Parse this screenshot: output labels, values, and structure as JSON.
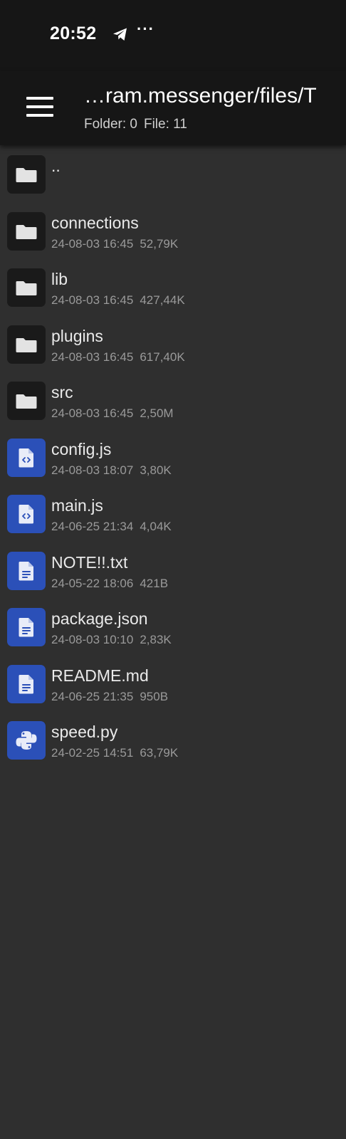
{
  "status_bar": {
    "time": "20:52",
    "notification_icon": "telegram-icon",
    "more_indicator": "···"
  },
  "toolbar": {
    "menu_icon": "hamburger-menu-icon",
    "path": "…ram.messenger/files/T",
    "folder_count": "Folder: 0",
    "file_count": "File: 11"
  },
  "files": [
    {
      "name": "..",
      "date": "",
      "size": "",
      "icon": "folder-icon"
    },
    {
      "name": "connections",
      "date": "24-08-03 16:45",
      "size": "52,79K",
      "icon": "folder-icon"
    },
    {
      "name": "lib",
      "date": "24-08-03 16:45",
      "size": "427,44K",
      "icon": "folder-icon"
    },
    {
      "name": "plugins",
      "date": "24-08-03 16:45",
      "size": "617,40K",
      "icon": "folder-icon"
    },
    {
      "name": "src",
      "date": "24-08-03 16:45",
      "size": "2,50M",
      "icon": "folder-icon"
    },
    {
      "name": "config.js",
      "date": "24-08-03 18:07",
      "size": "3,80K",
      "icon": "code-file-icon"
    },
    {
      "name": "main.js",
      "date": "24-06-25 21:34",
      "size": "4,04K",
      "icon": "code-file-icon"
    },
    {
      "name": "NOTE!!.txt",
      "date": "24-05-22 18:06",
      "size": "421B",
      "icon": "text-file-icon"
    },
    {
      "name": "package.json",
      "date": "24-08-03 10:10",
      "size": "2,83K",
      "icon": "text-file-icon"
    },
    {
      "name": "README.md",
      "date": "24-06-25 21:35",
      "size": "950B",
      "icon": "text-file-icon"
    },
    {
      "name": "speed.py",
      "date": "24-02-25 14:51",
      "size": "63,79K",
      "icon": "python-file-icon"
    }
  ],
  "colors": {
    "background": "#2f2f2f",
    "bar_background": "#161616",
    "folder_tile": "#1a1a1a",
    "file_tile": "#2b50b8",
    "primary_text": "#eaeaea",
    "secondary_text": "#9a9a9a"
  }
}
